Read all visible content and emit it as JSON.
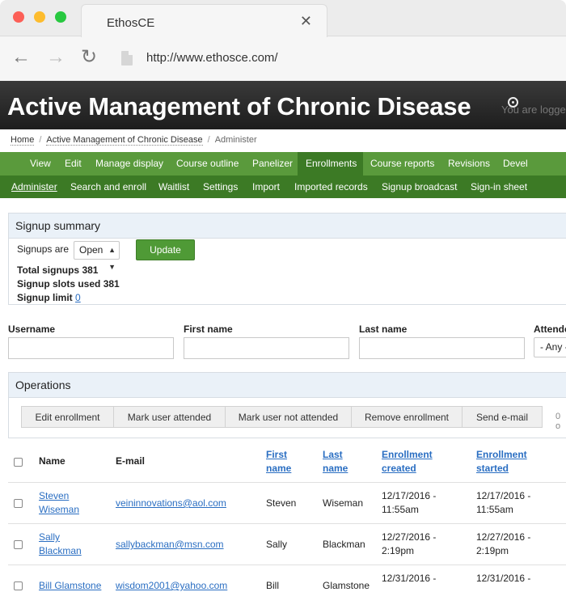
{
  "browser": {
    "tab_title": "EthosCE",
    "url": "http://www.ethosce.com/"
  },
  "header": {
    "title": "Active Management of Chronic Disease",
    "login_text": "You are logged in as"
  },
  "breadcrumb": [
    "Home",
    "Active Management of Chronic Disease",
    "Administer"
  ],
  "primary_tabs": [
    "View",
    "Edit",
    "Manage display",
    "Course outline",
    "Panelizer",
    "Enrollments",
    "Course reports",
    "Revisions",
    "Devel"
  ],
  "secondary_tabs": [
    "Administer",
    "Search and enroll",
    "Waitlist",
    "Settings",
    "Import",
    "Imported records",
    "Signup broadcast",
    "Sign-in sheet"
  ],
  "summary": {
    "legend": "Signup summary",
    "signups_label": "Signups are",
    "signups_status": "Open",
    "update_label": "Update",
    "total_label": "Total signups",
    "total_value": "381",
    "used_label": "Signup slots used",
    "used_value": "381",
    "limit_label": "Signup limit",
    "limit_value": "0"
  },
  "filters": {
    "username_label": "Username",
    "first_name_label": "First name",
    "last_name_label": "Last name",
    "attended_label": "Attended",
    "attended_value": "- Any -"
  },
  "operations": {
    "legend": "Operations",
    "buttons": [
      "Edit enrollment",
      "Mark user attended",
      "Mark user not attended",
      "Remove enrollment",
      "Send e-mail"
    ],
    "extra": "0 o"
  },
  "table": {
    "headers": {
      "name": "Name",
      "email": "E-mail",
      "first_name": "First name",
      "last_name": "Last name",
      "created": "Enrollment created",
      "started": "Enrollment started"
    },
    "rows": [
      {
        "name": "Steven Wiseman",
        "email": "veininnovations@aol.com",
        "first": "Steven",
        "last": "Wiseman",
        "created_date": "12/17/2016 -",
        "created_time": "11:55am",
        "started_date": "12/17/2016 -",
        "started_time": "11:55am"
      },
      {
        "name": "Sally Blackman",
        "email": "sallybackman@msn.com",
        "first": "Sally",
        "last": "Blackman",
        "created_date": "12/27/2016 -",
        "created_time": "2:19pm",
        "started_date": "12/27/2016 -",
        "started_time": "2:19pm"
      },
      {
        "name": "Bill Glamstone",
        "email": "wisdom2001@yahoo.com",
        "first": "Bill",
        "last": "Glamstone",
        "created_date": "12/31/2016 -",
        "created_time": "",
        "started_date": "12/31/2016 -",
        "started_time": ""
      }
    ]
  },
  "colors": {
    "primary_tab_bg": "#5a9a3c",
    "secondary_tab_bg": "#3c7a25",
    "link": "#2a6ec2",
    "legend_bg": "#eaf1f8"
  }
}
